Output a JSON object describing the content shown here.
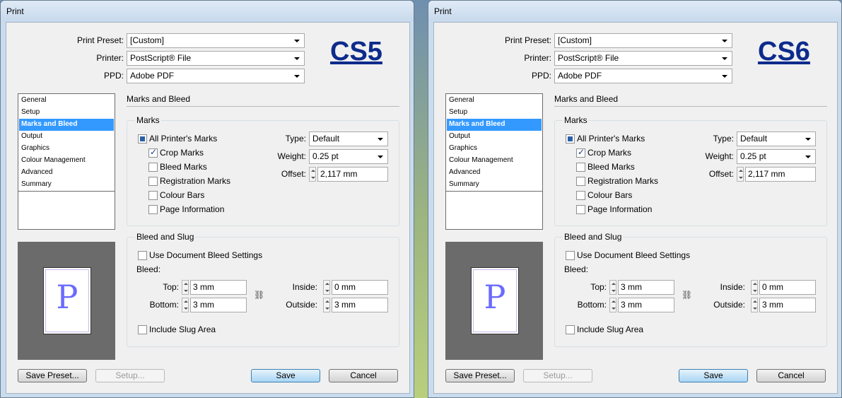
{
  "dialogs": [
    {
      "window_title": "Print",
      "badge": "CS5",
      "top": {
        "preset_label": "Print Preset:",
        "preset_value": "[Custom]",
        "printer_label": "Printer:",
        "printer_value": "PostScript® File",
        "ppd_label": "PPD:",
        "ppd_value": "Adobe PDF"
      },
      "nav_items": [
        "General",
        "Setup",
        "Marks and Bleed",
        "Output",
        "Graphics",
        "Colour Management",
        "Advanced",
        "Summary"
      ],
      "selected_nav": "Marks and Bleed",
      "section_title": "Marks and Bleed",
      "marks": {
        "group_title": "Marks",
        "all_printers_marks": "All Printer's Marks",
        "crop_marks": "Crop Marks",
        "bleed_marks": "Bleed Marks",
        "registration_marks": "Registration Marks",
        "colour_bars": "Colour Bars",
        "page_information": "Page Information",
        "type_label": "Type:",
        "type_value": "Default",
        "weight_label": "Weight:",
        "weight_value": "0.25 pt",
        "offset_label": "Offset:",
        "offset_value": "2,117 mm"
      },
      "bleed": {
        "group_title": "Bleed and Slug",
        "use_document": "Use Document Bleed Settings",
        "bleed_label": "Bleed:",
        "top_label": "Top:",
        "top_value": "3 mm",
        "bottom_label": "Bottom:",
        "bottom_value": "3 mm",
        "inside_label": "Inside:",
        "inside_value": "0 mm",
        "outside_label": "Outside:",
        "outside_value": "3 mm",
        "include_slug": "Include Slug Area"
      },
      "preview_letter": "P",
      "buttons": {
        "save_preset": "Save Preset...",
        "setup": "Setup...",
        "save": "Save",
        "cancel": "Cancel"
      }
    },
    {
      "window_title": "Print",
      "badge": "CS6",
      "top": {
        "preset_label": "Print Preset:",
        "preset_value": "[Custom]",
        "printer_label": "Printer:",
        "printer_value": "PostScript® File",
        "ppd_label": "PPD:",
        "ppd_value": "Adobe PDF"
      },
      "nav_items": [
        "General",
        "Setup",
        "Marks and Bleed",
        "Output",
        "Graphics",
        "Colour Management",
        "Advanced",
        "Summary"
      ],
      "selected_nav": "Marks and Bleed",
      "section_title": "Marks and Bleed",
      "marks": {
        "group_title": "Marks",
        "all_printers_marks": "All Printer's Marks",
        "crop_marks": "Crop Marks",
        "bleed_marks": "Bleed Marks",
        "registration_marks": "Registration Marks",
        "colour_bars": "Colour Bars",
        "page_information": "Page Information",
        "type_label": "Type:",
        "type_value": "Default",
        "weight_label": "Weight:",
        "weight_value": "0.25 pt",
        "offset_label": "Offset:",
        "offset_value": "2,117 mm"
      },
      "bleed": {
        "group_title": "Bleed and Slug",
        "use_document": "Use Document Bleed Settings",
        "bleed_label": "Bleed:",
        "top_label": "Top:",
        "top_value": "3 mm",
        "bottom_label": "Bottom:",
        "bottom_value": "3 mm",
        "inside_label": "Inside:",
        "inside_value": "0 mm",
        "outside_label": "Outside:",
        "outside_value": "3 mm",
        "include_slug": "Include Slug Area"
      },
      "preview_letter": "P",
      "buttons": {
        "save_preset": "Save Preset...",
        "setup": "Setup...",
        "save": "Save",
        "cancel": "Cancel"
      }
    }
  ],
  "colors": {
    "badge": "#0d2b8c",
    "selection": "#3399ff",
    "preview_background": "#6b6b6b",
    "preview_letter": "#6b6bff"
  },
  "icons": {
    "checkbox_mixed": "checkbox-mixed-icon",
    "checkbox_checked": "checkmark-icon",
    "link_chain": "chain-link-icon",
    "combo_arrow": "chevron-down-icon",
    "spinner": "spinner-arrows-icon"
  }
}
